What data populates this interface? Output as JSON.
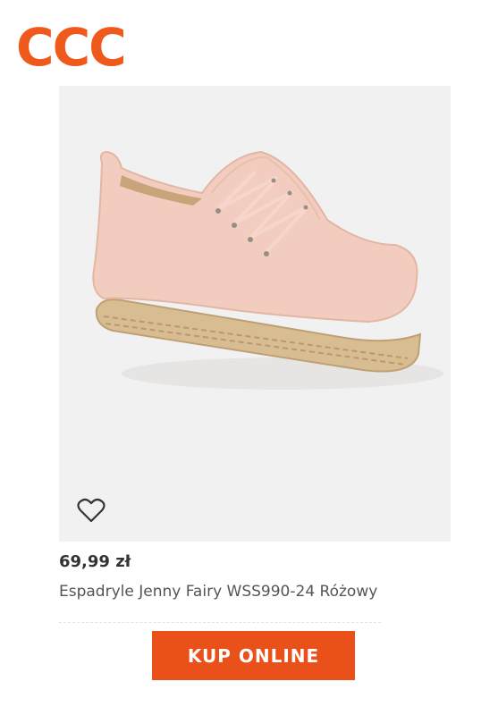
{
  "brand": {
    "logo_text": "CCC",
    "color": "#ef5a1c"
  },
  "product": {
    "image_alt": "shoe-image",
    "price": "69,99 zł",
    "name": "Espadryle Jenny Fairy WSS990-24 Różowy",
    "colors": {
      "upper": "#f2cdbf",
      "sole": "#d8bd92"
    }
  },
  "actions": {
    "favorite_icon": "heart-outline-icon",
    "buy_label": "KUP ONLINE",
    "buy_color": "#e9501a"
  }
}
